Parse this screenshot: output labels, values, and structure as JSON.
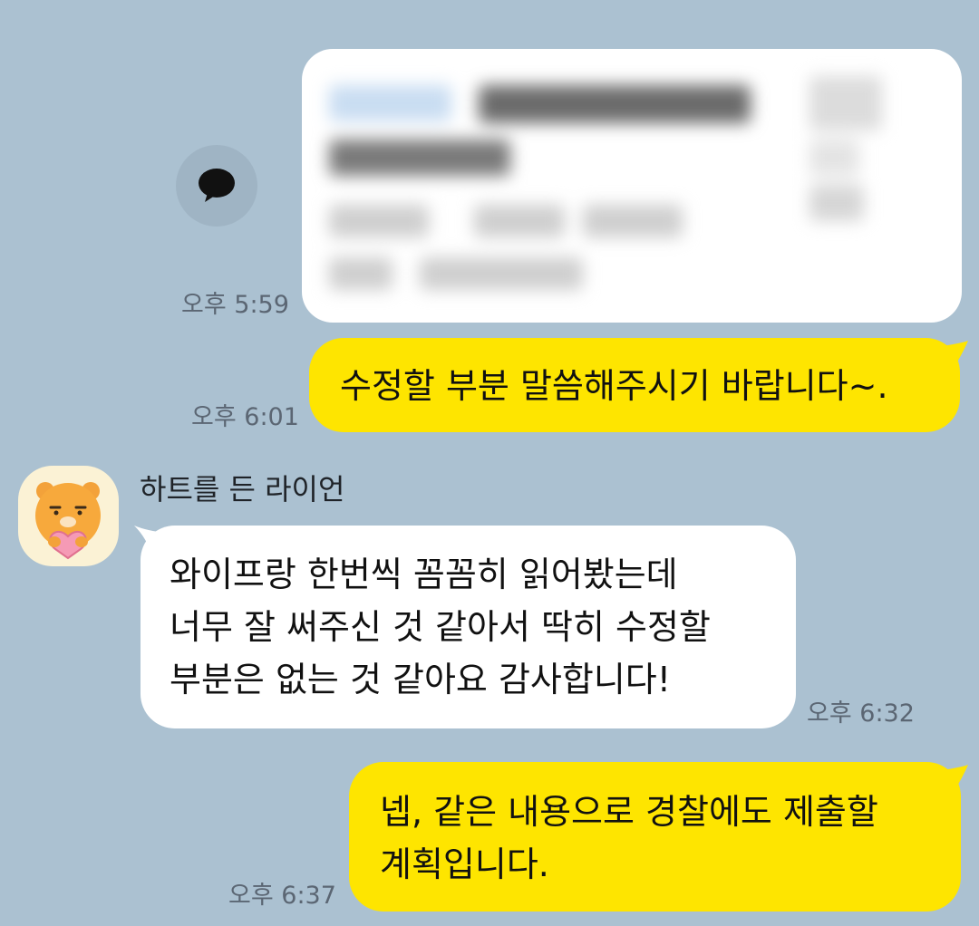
{
  "chat": {
    "messages": [
      {
        "id": "shared-card",
        "direction": "outgoing",
        "type": "blurred-content",
        "time": "오후 5:59"
      },
      {
        "id": "msg-1",
        "direction": "outgoing",
        "lines": [
          "수정할 부분 말씀해주시기 바랍니다~."
        ],
        "time": "오후 6:01"
      },
      {
        "id": "msg-2",
        "direction": "incoming",
        "sender": "하트를 든 라이언",
        "lines": [
          "와이프랑 한번씩 꼼꼼히 읽어봤는데",
          "너무 잘 써주신 것 같아서 딱히 수정할",
          "부분은 없는 것 같아요 감사합니다!"
        ],
        "time": "오후 6:32"
      },
      {
        "id": "msg-3",
        "direction": "outgoing",
        "lines": [
          "넵, 같은 내용으로 경찰에도 제출할",
          "계획입니다."
        ],
        "time": "오후 6:37"
      }
    ]
  },
  "icons": {
    "share": "speech-bubble-icon",
    "avatar": "ryan-lion-holding-heart"
  },
  "colors": {
    "background": "#abc1d1",
    "outgoing_bubble": "#fee500",
    "incoming_bubble": "#ffffff",
    "timestamp": "#5b6673"
  }
}
